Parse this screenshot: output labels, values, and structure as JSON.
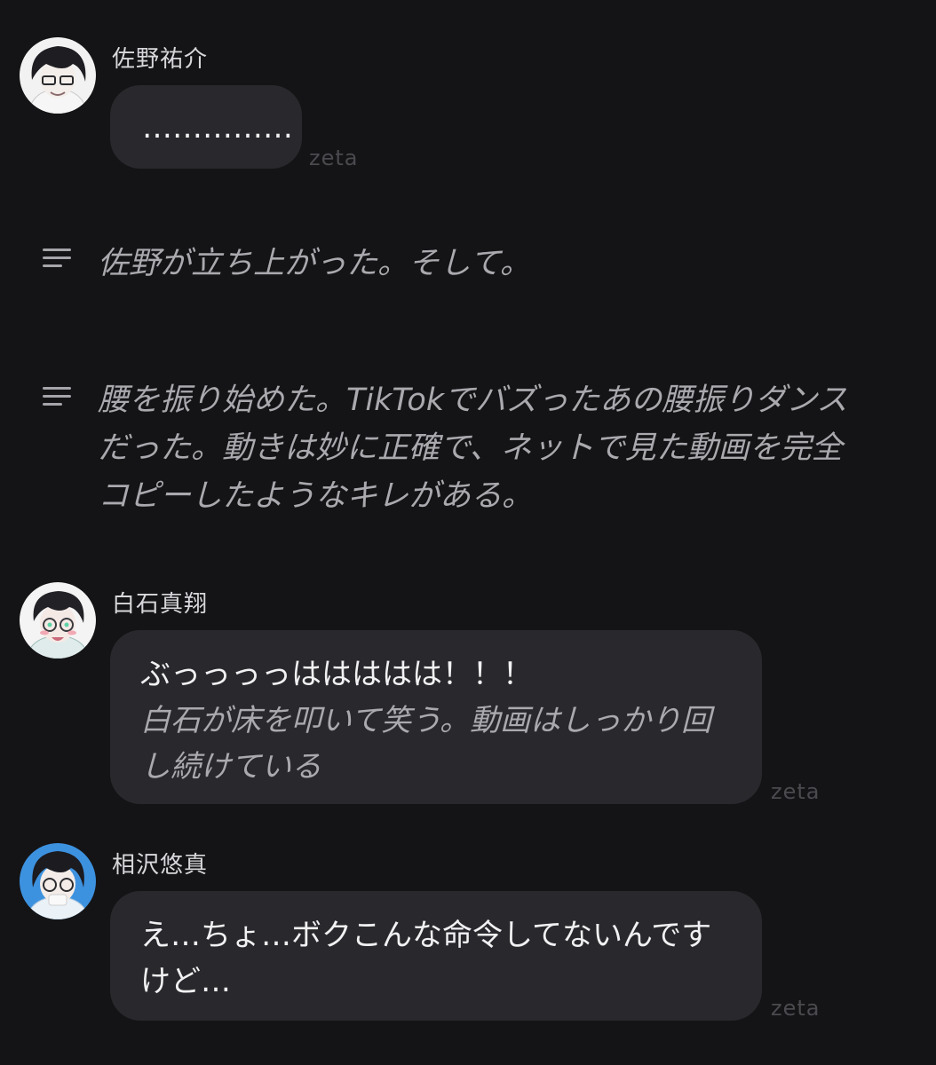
{
  "messages": [
    {
      "name": "佐野祐介",
      "speech": "……………",
      "action": "",
      "stamp": "zeta"
    },
    {
      "name": "白石真翔",
      "speech": "ぶっっっっははははは！！！",
      "action": "白石が床を叩いて笑う。動画はしっかり回し続けている",
      "stamp": "zeta"
    },
    {
      "name": "相沢悠真",
      "speech": "え…ちょ…ボクこんな命令してないんですけど…",
      "action": "",
      "stamp": "zeta"
    }
  ],
  "narrations": [
    {
      "icon": "narration-lines-icon",
      "text": "佐野が立ち上がった。そして。"
    },
    {
      "icon": "narration-lines-icon",
      "text": "腰を振り始めた。TikTokでバズったあの腰振りダンスだった。動きは妙に正確で、ネットで見た動画を完全コピーしたようなキレがある。"
    }
  ],
  "colors": {
    "background": "#141416",
    "bubble": "#29292d",
    "action_text": "#a9a9ae",
    "stamp": "#4a4a4f"
  }
}
